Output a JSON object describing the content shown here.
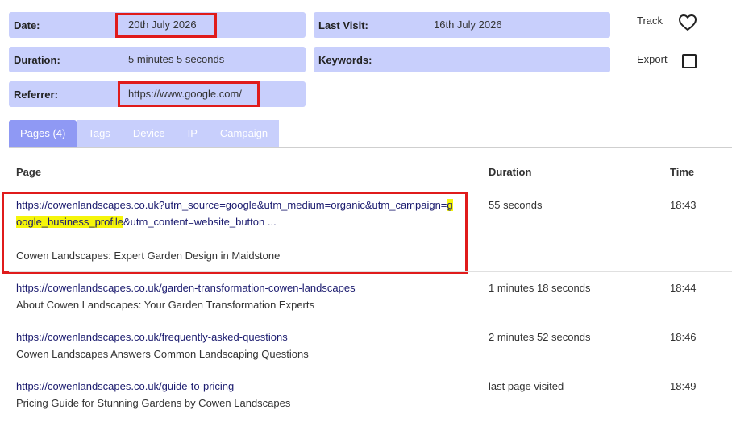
{
  "visit": {
    "date_label": "Date:",
    "date_value": "20th July 2026",
    "last_visit_label": "Last Visit:",
    "last_visit_value": "16th July 2026",
    "duration_label": "Duration:",
    "duration_value": "5 minutes 5 seconds",
    "keywords_label": "Keywords:",
    "keywords_value": "",
    "referrer_label": "Referrer:",
    "referrer_value": "https://www.google.com/"
  },
  "actions": {
    "track_label": "Track",
    "track_icon": "heart-icon",
    "export_label": "Export",
    "export_checked": false
  },
  "tabs": [
    {
      "label": "Pages (4)",
      "active": true
    },
    {
      "label": "Tags",
      "active": false
    },
    {
      "label": "Device",
      "active": false
    },
    {
      "label": "IP",
      "active": false
    },
    {
      "label": "Campaign",
      "active": false
    }
  ],
  "table": {
    "headers": {
      "page": "Page",
      "duration": "Duration",
      "time": "Time"
    },
    "rows": [
      {
        "url_before": "https://cowenlandscapes.co.uk?utm_source=google&utm_medium=organic&utm_campaign=",
        "url_highlight": "google_business_profile",
        "url_after": "&utm_content=website_button ...",
        "title": "Cowen Landscapes: Expert Garden Design in Maidstone",
        "duration": "55 seconds",
        "time": "18:43"
      },
      {
        "url": "https://cowenlandscapes.co.uk/garden-transformation-cowen-landscapes",
        "title": "About Cowen Landscapes: Your Garden Transformation Experts",
        "duration": "1 minutes 18 seconds",
        "time": "18:44"
      },
      {
        "url": "https://cowenlandscapes.co.uk/frequently-asked-questions",
        "title": "Cowen Landscapes Answers Common Landscaping Questions",
        "duration": "2 minutes 52 seconds",
        "time": "18:46"
      },
      {
        "url": "https://cowenlandscapes.co.uk/guide-to-pricing",
        "title": "Pricing Guide for Stunning Gardens by Cowen Landscapes",
        "duration": "last page visited",
        "time": "18:49"
      }
    ]
  },
  "colors": {
    "field_bg": "#c8cffc",
    "tab_active": "#8f99f4",
    "annotation_red": "#e01b1b",
    "highlight_yellow": "#f5f50a",
    "link": "#1a1a6e"
  }
}
